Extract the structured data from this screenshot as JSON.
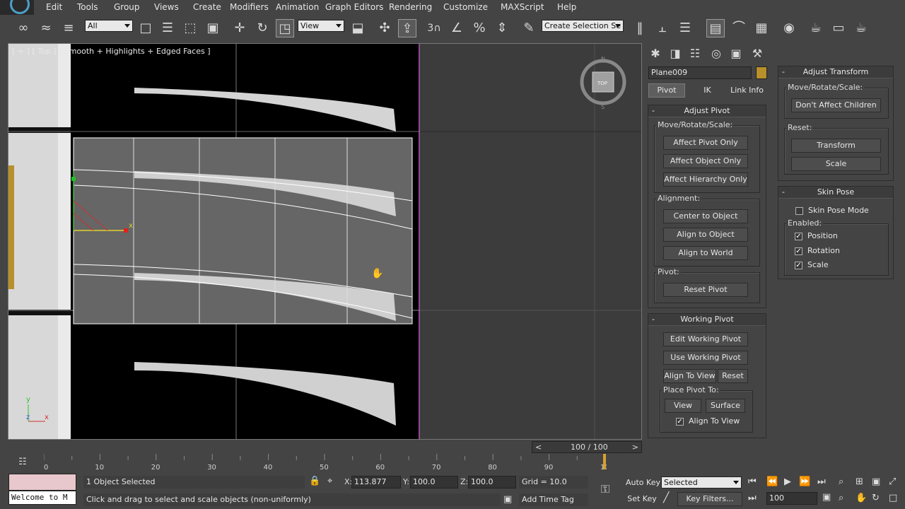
{
  "menubar": {
    "items": [
      "Edit",
      "Tools",
      "Group",
      "Views",
      "Create",
      "Modifiers",
      "Animation",
      "Graph Editors",
      "Rendering",
      "Customize",
      "MAXScript",
      "Help"
    ]
  },
  "toolbar": {
    "filter_value": "All",
    "ref_coord_value": "View",
    "snaps_label": "3",
    "selection_set_value": "Create Selection Se"
  },
  "viewport": {
    "label": "[ + ] [ Top ] [ Smooth + Highlights + Edged Faces ]",
    "axis_y": "y",
    "axis_x": "x",
    "axis_z": "z",
    "gizmo_x": "x",
    "viewcube_label": "TOP",
    "viewcube_n": "N",
    "viewcube_s": "S"
  },
  "command_panel": {
    "object_name": "Plane009",
    "object_color": "#b8902a",
    "tabs": [
      "Pivot",
      "IK",
      "Link Info"
    ],
    "adjust_pivot": {
      "title": "Adjust Pivot",
      "move_label": "Move/Rotate/Scale:",
      "buttons": [
        "Affect Pivot Only",
        "Affect Object Only",
        "Affect Hierarchy Only"
      ],
      "alignment_label": "Alignment:",
      "align_buttons": [
        "Center to Object",
        "Align to Object",
        "Align to World"
      ],
      "pivot_label": "Pivot:",
      "reset_pivot": "Reset Pivot"
    },
    "working_pivot": {
      "title": "Working Pivot",
      "edit": "Edit Working Pivot",
      "use": "Use Working Pivot",
      "align_to_view": "Align To View",
      "reset": "Reset",
      "place_label": "Place Pivot To:",
      "view": "View",
      "surface": "Surface",
      "align_check": "Align To View"
    }
  },
  "right_panel": {
    "adjust_transform": {
      "title": "Adjust Transform",
      "move_label": "Move/Rotate/Scale:",
      "dont_affect": "Don't Affect Children",
      "reset_label": "Reset:",
      "transform": "Transform",
      "scale": "Scale"
    },
    "skin_pose": {
      "title": "Skin Pose",
      "mode": "Skin Pose Mode",
      "enabled_label": "Enabled:",
      "position": "Position",
      "rotation": "Rotation",
      "scale": "Scale"
    }
  },
  "timeline": {
    "frame_display": "100 / 100",
    "ticks": [
      "0",
      "10",
      "20",
      "30",
      "40",
      "50",
      "60",
      "70",
      "80",
      "90",
      "100"
    ],
    "current_frame": 100
  },
  "status": {
    "maxscript": "Welcome to M",
    "selected": "1 Object Selected",
    "prompt": "Click and drag to select and scale objects (non-uniformly)",
    "x_label": "X:",
    "x_value": "113.877",
    "y_label": "Y:",
    "y_value": "100.0",
    "z_label": "Z:",
    "z_value": "100.0",
    "grid": "Grid = 10.0",
    "add_time_tag": "Add Time Tag",
    "auto_key": "Auto Key",
    "set_key": "Set Key",
    "selected_dropdown": "Selected",
    "key_filters": "Key Filters...",
    "frame_value": "100"
  }
}
